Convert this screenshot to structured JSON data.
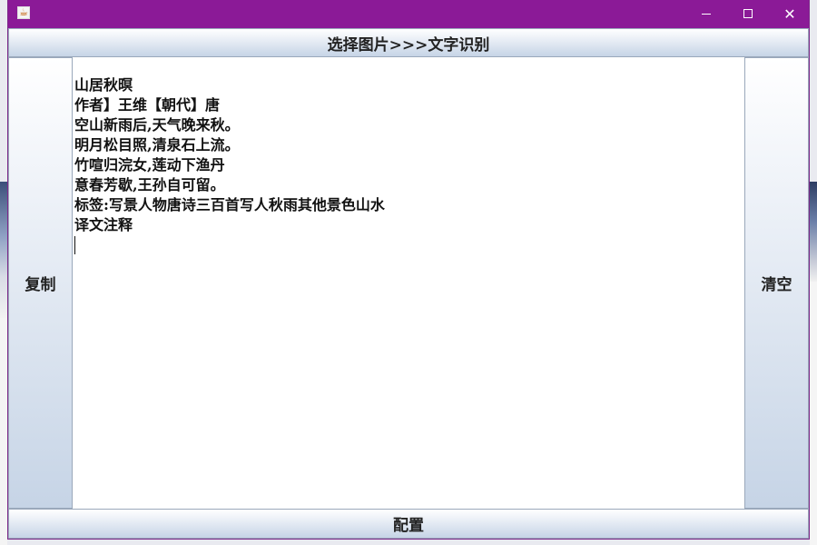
{
  "window": {
    "app_icon": "java-cup-icon",
    "controls": {
      "minimize": "minimize-icon",
      "maximize": "maximize-icon",
      "close": "close-icon",
      "close_glyph": "✕"
    }
  },
  "buttons": {
    "select_image": "选择图片>>>文字识别",
    "copy": "复制",
    "clear": "清空",
    "config": "配置"
  },
  "result_text": {
    "lines": [
      "山居秋暝",
      "作者】王维【朝代】唐",
      "空山新雨后,天气晚来秋。",
      "明月松目照,清泉石上流。",
      "竹喧归浣女,莲动下渔丹",
      "意春芳歇,王孙自可留。",
      "标签:写景人物唐诗三百首写人秋雨其他景色山水",
      "译文注释"
    ]
  },
  "colors": {
    "titlebar": "#8b1a97",
    "button_gradient_bottom": "#c6d4e6"
  }
}
